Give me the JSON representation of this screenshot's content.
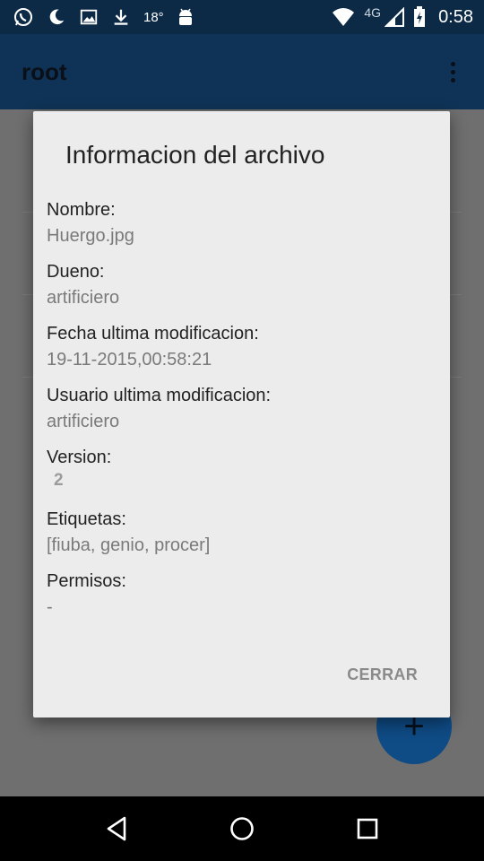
{
  "status_bar": {
    "temperature": "18°",
    "network": "4G",
    "time": "0:58",
    "icons": [
      "whatsapp-icon",
      "moon-icon",
      "gallery-icon",
      "download-icon",
      "android-icon",
      "wifi-icon",
      "signal-icon",
      "battery-icon"
    ]
  },
  "app_bar": {
    "title": "root"
  },
  "fab": {
    "label": "+"
  },
  "dialog": {
    "title": "Informacion del archivo",
    "fields": [
      {
        "label": "Nombre:",
        "value": "Huergo.jpg"
      },
      {
        "label": "Dueno:",
        "value": "artificiero"
      },
      {
        "label": "Fecha ultima modificacion:",
        "value": "19-11-2015,00:58:21"
      },
      {
        "label": "Usuario ultima modificacion:",
        "value": "artificiero"
      },
      {
        "label": "Version:",
        "value": "2"
      },
      {
        "label": "Etiquetas:",
        "value": "[fiuba, genio, procer]"
      },
      {
        "label": "Permisos:",
        "value": "-"
      }
    ],
    "close_label": "CERRAR"
  },
  "colors": {
    "status_bar": "#0c2a45",
    "app_bar_dimmed": "#0f3356",
    "dialog_bg": "#ececec",
    "fab_dimmed": "#0f4b85"
  }
}
